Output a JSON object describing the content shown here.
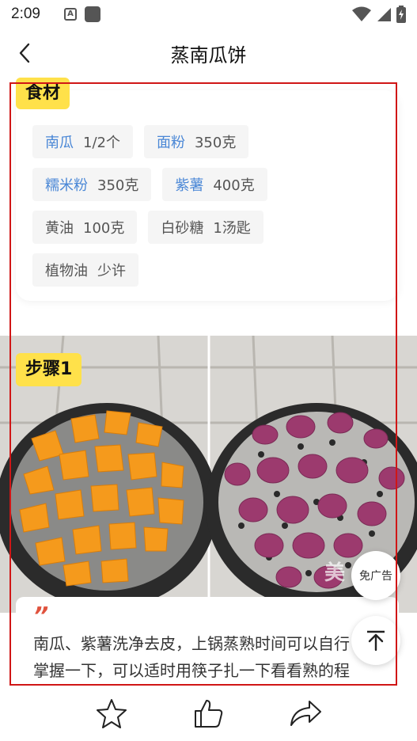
{
  "status_bar": {
    "time": "2:09",
    "notification_letter": "A"
  },
  "nav": {
    "title": "蒸南瓜饼"
  },
  "ingredients": {
    "section_title": "食材",
    "items": [
      {
        "name": "南瓜",
        "qty": "1/2个",
        "linked": true
      },
      {
        "name": "面粉",
        "qty": "350克",
        "linked": true
      },
      {
        "name": "糯米粉",
        "qty": "350克",
        "linked": true
      },
      {
        "name": "紫薯",
        "qty": "400克",
        "linked": true
      },
      {
        "name": "黄油",
        "qty": "100克",
        "linked": false
      },
      {
        "name": "白砂糖",
        "qty": "1汤匙",
        "linked": false
      },
      {
        "name": "植物油",
        "qty": "少许",
        "linked": false
      }
    ]
  },
  "step": {
    "title": "步骤1",
    "quote_mark": "”",
    "text_line1": "南瓜、紫薯洗净去皮，上锅蒸熟时间可以自行",
    "text_line2": "掌握一下，可以适时用筷子扎一下看看熟的程",
    "watermark": "美"
  },
  "floating": {
    "ad_label": "免广告"
  },
  "colors": {
    "accent_yellow": "#ffe14a",
    "link_blue": "#4a87d6",
    "quote_red": "#e0533e",
    "highlight_red": "#d01616"
  }
}
